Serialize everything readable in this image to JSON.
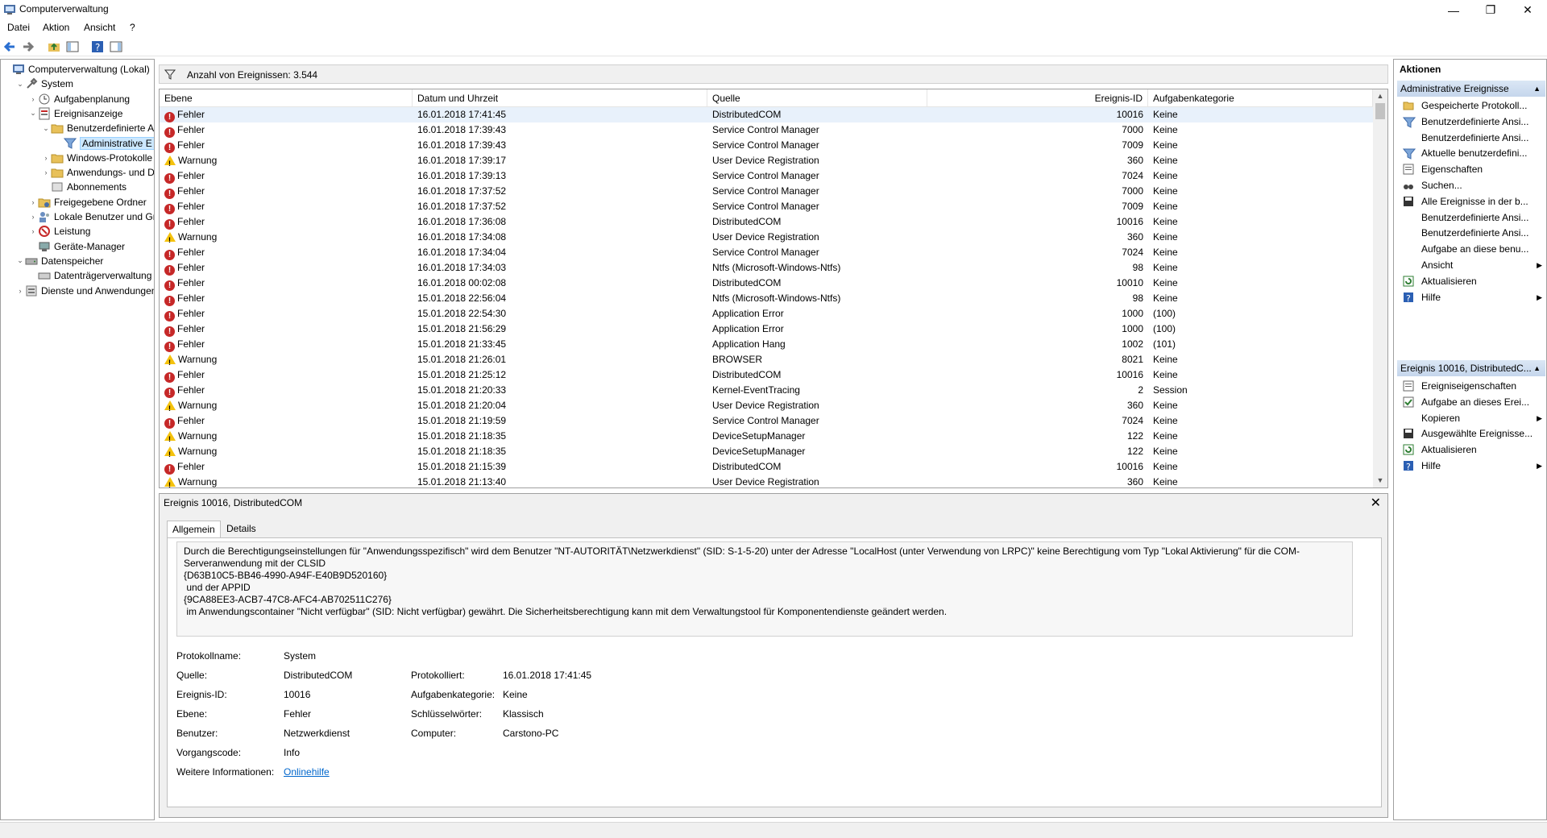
{
  "window": {
    "title": "Computerverwaltung",
    "minimize": "—",
    "restore": "❐",
    "close": "✕"
  },
  "menu": [
    "Datei",
    "Aktion",
    "Ansicht",
    "?"
  ],
  "tree": [
    {
      "label": "Computerverwaltung (Lokal)",
      "level": 0,
      "arrow": "",
      "icon": "computer-icon"
    },
    {
      "label": "System",
      "level": 1,
      "arrow": "down",
      "icon": "tools-icon"
    },
    {
      "label": "Aufgabenplanung",
      "level": 2,
      "arrow": "right",
      "icon": "clock-icon"
    },
    {
      "label": "Ereignisanzeige",
      "level": 2,
      "arrow": "down",
      "icon": "event-viewer-icon"
    },
    {
      "label": "Benutzerdefinierte A",
      "level": 3,
      "arrow": "down",
      "icon": "folder-icon"
    },
    {
      "label": "Administrative E",
      "level": 4,
      "arrow": "",
      "icon": "filter-icon",
      "selected": true
    },
    {
      "label": "Windows-Protokolle",
      "level": 3,
      "arrow": "right",
      "icon": "folder-icon"
    },
    {
      "label": "Anwendungs- und D",
      "level": 3,
      "arrow": "right",
      "icon": "folder-icon"
    },
    {
      "label": "Abonnements",
      "level": 3,
      "arrow": "",
      "icon": "subscriptions-icon"
    },
    {
      "label": "Freigegebene Ordner",
      "level": 2,
      "arrow": "right",
      "icon": "shared-folder-icon"
    },
    {
      "label": "Lokale Benutzer und Gr",
      "level": 2,
      "arrow": "right",
      "icon": "users-icon"
    },
    {
      "label": "Leistung",
      "level": 2,
      "arrow": "right",
      "icon": "performance-icon"
    },
    {
      "label": "Geräte-Manager",
      "level": 2,
      "arrow": "",
      "icon": "device-manager-icon"
    },
    {
      "label": "Datenspeicher",
      "level": 1,
      "arrow": "down",
      "icon": "storage-icon"
    },
    {
      "label": "Datenträgerverwaltung",
      "level": 2,
      "arrow": "",
      "icon": "disk-icon"
    },
    {
      "label": "Dienste und Anwendungen",
      "level": 1,
      "arrow": "right",
      "icon": "services-icon"
    }
  ],
  "center": {
    "count_label": "Anzahl von Ereignissen: 3.544"
  },
  "table": {
    "columns": [
      "Ebene",
      "Datum und Uhrzeit",
      "Quelle",
      "Ereignis-ID",
      "Aufgabenkategorie"
    ],
    "rows": [
      [
        "Fehler",
        "16.01.2018 17:41:45",
        "DistributedCOM",
        "10016",
        "Keine"
      ],
      [
        "Fehler",
        "16.01.2018 17:39:43",
        "Service Control Manager",
        "7000",
        "Keine"
      ],
      [
        "Fehler",
        "16.01.2018 17:39:43",
        "Service Control Manager",
        "7009",
        "Keine"
      ],
      [
        "Warnung",
        "16.01.2018 17:39:17",
        "User Device Registration",
        "360",
        "Keine"
      ],
      [
        "Fehler",
        "16.01.2018 17:39:13",
        "Service Control Manager",
        "7024",
        "Keine"
      ],
      [
        "Fehler",
        "16.01.2018 17:37:52",
        "Service Control Manager",
        "7000",
        "Keine"
      ],
      [
        "Fehler",
        "16.01.2018 17:37:52",
        "Service Control Manager",
        "7009",
        "Keine"
      ],
      [
        "Fehler",
        "16.01.2018 17:36:08",
        "DistributedCOM",
        "10016",
        "Keine"
      ],
      [
        "Warnung",
        "16.01.2018 17:34:08",
        "User Device Registration",
        "360",
        "Keine"
      ],
      [
        "Fehler",
        "16.01.2018 17:34:04",
        "Service Control Manager",
        "7024",
        "Keine"
      ],
      [
        "Fehler",
        "16.01.2018 17:34:03",
        "Ntfs (Microsoft-Windows-Ntfs)",
        "98",
        "Keine"
      ],
      [
        "Fehler",
        "16.01.2018 00:02:08",
        "DistributedCOM",
        "10010",
        "Keine"
      ],
      [
        "Fehler",
        "15.01.2018 22:56:04",
        "Ntfs (Microsoft-Windows-Ntfs)",
        "98",
        "Keine"
      ],
      [
        "Fehler",
        "15.01.2018 22:54:30",
        "Application Error",
        "1000",
        "(100)"
      ],
      [
        "Fehler",
        "15.01.2018 21:56:29",
        "Application Error",
        "1000",
        "(100)"
      ],
      [
        "Fehler",
        "15.01.2018 21:33:45",
        "Application Hang",
        "1002",
        "(101)"
      ],
      [
        "Warnung",
        "15.01.2018 21:26:01",
        "BROWSER",
        "8021",
        "Keine"
      ],
      [
        "Fehler",
        "15.01.2018 21:25:12",
        "DistributedCOM",
        "10016",
        "Keine"
      ],
      [
        "Fehler",
        "15.01.2018 21:20:33",
        "Kernel-EventTracing",
        "2",
        "Session"
      ],
      [
        "Warnung",
        "15.01.2018 21:20:04",
        "User Device Registration",
        "360",
        "Keine"
      ],
      [
        "Fehler",
        "15.01.2018 21:19:59",
        "Service Control Manager",
        "7024",
        "Keine"
      ],
      [
        "Warnung",
        "15.01.2018 21:18:35",
        "DeviceSetupManager",
        "122",
        "Keine"
      ],
      [
        "Warnung",
        "15.01.2018 21:18:35",
        "DeviceSetupManager",
        "122",
        "Keine"
      ],
      [
        "Fehler",
        "15.01.2018 21:15:39",
        "DistributedCOM",
        "10016",
        "Keine"
      ],
      [
        "Warnung",
        "15.01.2018 21:13:40",
        "User Device Registration",
        "360",
        "Keine"
      ]
    ]
  },
  "detail": {
    "title": "Ereignis 10016, DistributedCOM",
    "close": "✕",
    "tabs": [
      "Allgemein",
      "Details"
    ],
    "description": "Durch die Berechtigungseinstellungen für \"Anwendungsspezifisch\" wird dem Benutzer \"NT-AUTORITÄT\\Netzwerkdienst\" (SID: S-1-5-20) unter der Adresse \"LocalHost (unter Verwendung von LRPC)\" keine Berechtigung vom Typ \"Lokal Aktivierung\" für die COM-Serveranwendung mit der CLSID\n{D63B10C5-BB46-4990-A94F-E40B9D520160}\n und der APPID\n{9CA88EE3-ACB7-47C8-AFC4-AB702511C276}\n im Anwendungscontainer \"Nicht verfügbar\" (SID: Nicht verfügbar) gewährt. Die Sicherheitsberechtigung kann mit dem Verwaltungstool für Komponentendienste geändert werden.",
    "fields": {
      "protokollname_label": "Protokollname:",
      "protokollname": "System",
      "quelle_label": "Quelle:",
      "quelle": "DistributedCOM",
      "protokolliert_label": "Protokolliert:",
      "protokolliert": "16.01.2018 17:41:45",
      "ereignis_id_label": "Ereignis-ID:",
      "ereignis_id": "10016",
      "aufgabenkategorie_label": "Aufgabenkategorie:",
      "aufgabenkategorie": "Keine",
      "ebene_label": "Ebene:",
      "ebene": "Fehler",
      "schluesselwoerter_label": "Schlüsselwörter:",
      "schluesselwoerter": "Klassisch",
      "benutzer_label": "Benutzer:",
      "benutzer": "Netzwerkdienst",
      "computer_label": "Computer:",
      "computer": "Carstono-PC",
      "vorgangscode_label": "Vorgangscode:",
      "vorgangscode": "Info",
      "weitere_label": "Weitere Informationen:",
      "weitere_link": "Onlinehilfe"
    }
  },
  "actions": {
    "header": "Aktionen",
    "section1": "Administrative Ereignisse",
    "items1": [
      {
        "label": "Gespeicherte Protokoll...",
        "icon": "open-log-icon"
      },
      {
        "label": "Benutzerdefinierte Ansi...",
        "icon": "filter-icon"
      },
      {
        "label": "Benutzerdefinierte Ansi...",
        "icon": ""
      },
      {
        "label": "Aktuelle benutzerdefini...",
        "icon": "filter-icon"
      },
      {
        "label": "Eigenschaften",
        "icon": "properties-icon"
      },
      {
        "label": "Suchen...",
        "icon": "binoculars-icon"
      },
      {
        "label": "Alle Ereignisse in der b...",
        "icon": "save-icon"
      },
      {
        "label": "Benutzerdefinierte Ansi...",
        "icon": ""
      },
      {
        "label": "Benutzerdefinierte Ansi...",
        "icon": ""
      },
      {
        "label": "Aufgabe an diese benu...",
        "icon": ""
      },
      {
        "label": "Ansicht",
        "icon": "",
        "submenu": true
      },
      {
        "label": "Aktualisieren",
        "icon": "refresh-icon"
      },
      {
        "label": "Hilfe",
        "icon": "help-icon",
        "submenu": true
      }
    ],
    "section2": "Ereignis 10016, DistributedC...",
    "items2": [
      {
        "label": "Ereigniseigenschaften",
        "icon": "properties-icon"
      },
      {
        "label": "Aufgabe an dieses Erei...",
        "icon": "task-icon"
      },
      {
        "label": "Kopieren",
        "icon": "",
        "submenu": true
      },
      {
        "label": "Ausgewählte Ereignisse...",
        "icon": "save-icon"
      },
      {
        "label": "Aktualisieren",
        "icon": "refresh-icon"
      },
      {
        "label": "Hilfe",
        "icon": "help-icon",
        "submenu": true
      }
    ]
  },
  "colors": {
    "error": "#c62828",
    "warning": "#f4c20d",
    "selection": "#cce8ff",
    "link": "#0066cc",
    "band": "#c5d6ec"
  }
}
